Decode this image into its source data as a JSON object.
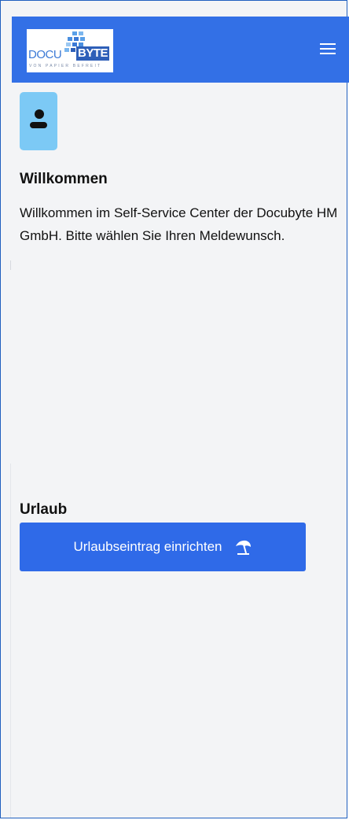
{
  "header": {
    "logo_left": "DOCU",
    "logo_right": "BYTE",
    "logo_tagline": "VON PAPIER BEFREIT",
    "menu_icon": "hamburger-menu-icon",
    "background_color": "#3370e6"
  },
  "welcome": {
    "avatar_icon": "user-icon",
    "title": "Willkommen",
    "text": "Willkommen im Self-Service Center der Docubyte HM GmbH. Bitte wählen Sie Ihren Meldewunsch."
  },
  "vacation": {
    "title": "Urlaub",
    "button_label": "Urlaubseintrag einrichten",
    "button_icon": "beach-umbrella-icon",
    "button_color": "#2f6ae8"
  }
}
